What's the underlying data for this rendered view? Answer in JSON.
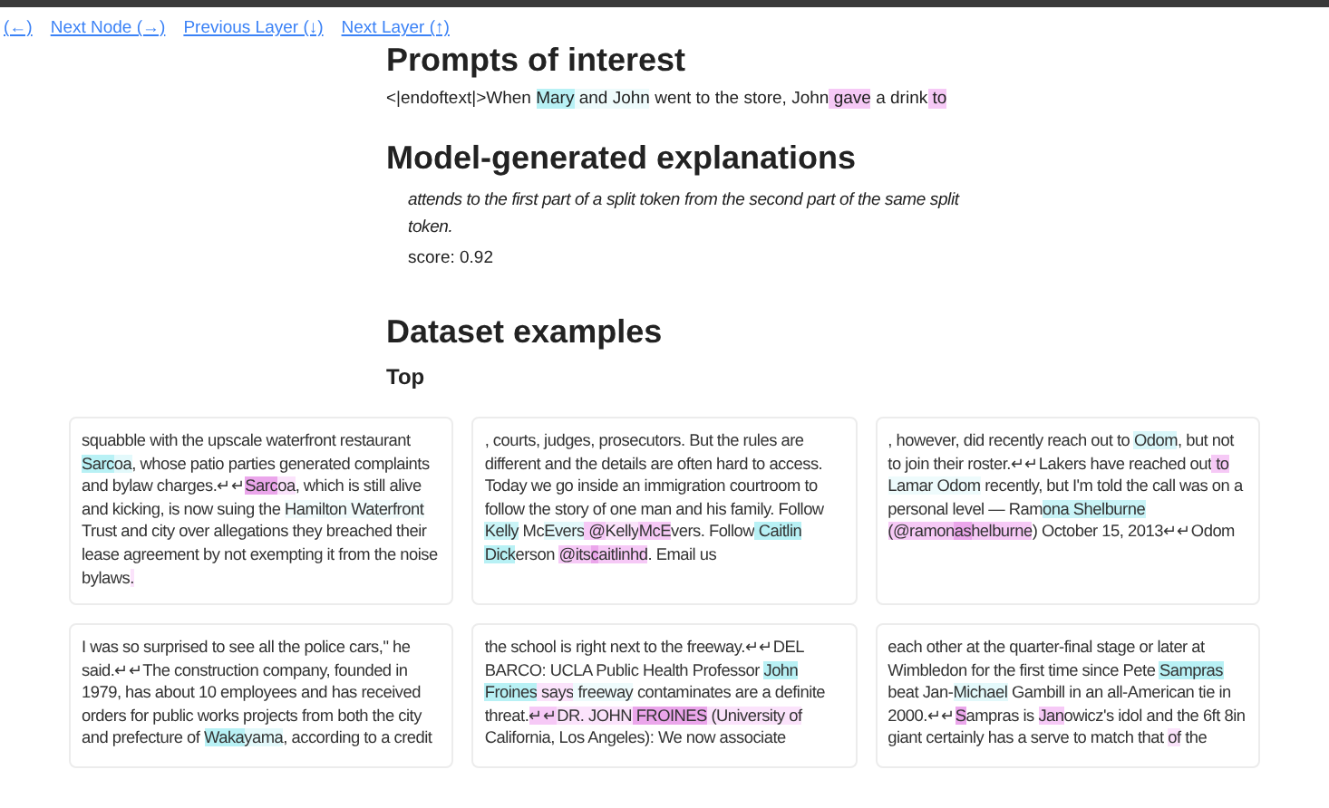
{
  "nav_links": [
    "(←)",
    "Next Node (→)",
    "Previous Layer (↓)",
    "Next Layer (↑)"
  ],
  "prompts": {
    "heading": "Prompts of interest",
    "segments": [
      {
        "text": "<|endoftext|>When "
      },
      {
        "text": "Mary",
        "color": "#b8f1f5"
      },
      {
        "text": " and John",
        "color": "#eefbfc"
      },
      {
        "text": " went to the store, John"
      },
      {
        "text": " gave",
        "color": "#f6c9f6"
      },
      {
        "text": " a drink"
      },
      {
        "text": " to",
        "color": "#f6c9f6"
      }
    ]
  },
  "explanations": {
    "heading": "Model-generated explanations",
    "text": "attends to the first part of a split token from the second part of the same split token.",
    "score": "score: 0.92"
  },
  "dataset": {
    "heading": "Dataset examples",
    "subheading": "Top",
    "examples": [
      [
        {
          "text": " squabble with the upscale waterfront restaurant"
        },
        {
          "text": " Sarc",
          "color": "#b8f1f5"
        },
        {
          "text": "oa",
          "color": "#e3f9fb"
        },
        {
          "text": ", whose patio parties generated complaints and bylaw charges.↵↵"
        },
        {
          "text": "Sarc",
          "color": "#eba6eb"
        },
        {
          "text": "oa",
          "color": "#fbe3fb"
        },
        {
          "text": ", which is still alive and kicking, is now suing the "
        },
        {
          "text": "Hamilton Waterfront",
          "color": "#f1fbfc"
        },
        {
          "text": " Trust and city over allegations they breached their lease agreement by not exempting it from the noise bylaws"
        },
        {
          "text": ".",
          "color": "#fbe3fb"
        }
      ],
      [
        {
          "text": ", courts, judges, prosecutors. But the rules are different and the details are often hard to access. Today we go inside an immigration courtroom to follow the story of one man and his family. Follow"
        },
        {
          "text": " Kelly",
          "color": "#c9f4f7"
        },
        {
          "text": " Mc"
        },
        {
          "text": "Evers",
          "color": "#e3f9fb"
        },
        {
          "text": " @",
          "color": "#f6c9f6"
        },
        {
          "text": "Kelly",
          "color": "#fbe3fb"
        },
        {
          "text": "McE",
          "color": "#f6c9f6"
        },
        {
          "text": "vers. Follow"
        },
        {
          "text": " Caitlin",
          "color": "#b8f1f5"
        },
        {
          "text": " Dick",
          "color": "#b8f1f5"
        },
        {
          "text": "erson "
        },
        {
          "text": "@its",
          "color": "#f6c9f6"
        },
        {
          "text": "c",
          "color": "#eba6eb"
        },
        {
          "text": "aitlinhd",
          "color": "#f6c9f6"
        },
        {
          "text": ". Email us"
        }
      ],
      [
        {
          "text": ", however, did recently reach out to "
        },
        {
          "text": "Odom",
          "color": "#d9f7fa"
        },
        {
          "text": ", but not to join their roster.↵↵Lakers have reached out"
        },
        {
          "text": " to",
          "color": "#f6c9f6"
        },
        {
          "text": " Lamar Odom",
          "color": "#eefbfc"
        },
        {
          "text": " recently, but I'm told the call was on a personal level — Ram"
        },
        {
          "text": "ona Shelburne",
          "color": "#c9f4f7"
        },
        {
          "text": " (@ramon",
          "color": "#f6c9f6"
        },
        {
          "text": "as",
          "color": "#eba6eb"
        },
        {
          "text": "helburne",
          "color": "#f6c9f6"
        },
        {
          "text": ") October 15, 2013↵↵Odom"
        }
      ],
      [
        {
          "text": "I was so surprised to see all the police cars,\" he said.↵↵The construction company, founded in 1979, has about 10 employees and has received orders for public works projects from both the city and prefecture of "
        },
        {
          "text": "Waka",
          "color": "#b8f1f5"
        },
        {
          "text": "yama",
          "color": "#e3f9fb"
        },
        {
          "text": ", according to a credit"
        }
      ],
      [
        {
          "text": " the school is right next to the freeway.↵↵DEL BARCO: UCLA Public Health Professor "
        },
        {
          "text": "John ",
          "color": "#b8f1f5"
        },
        {
          "text": "Froines",
          "color": "#b8f1f5"
        },
        {
          "text": " says",
          "color": "#fbe3fb"
        },
        {
          "text": " freeway",
          "color": "#eefbfc"
        },
        {
          "text": " contaminates are a definite threat."
        },
        {
          "text": "↵↵",
          "color": "#f6c9f6"
        },
        {
          "text": "DR. JOHN",
          "color": "#fbe3fb"
        },
        {
          "text": " FROINES",
          "color": "#eba6eb"
        },
        {
          "text": " (University of",
          "color": "#fbe3fb"
        },
        {
          "text": " California, Los Angeles): We now associate"
        }
      ],
      [
        {
          "text": " each other at the quarter-final stage or later at Wimbledon for the first time since Pete "
        },
        {
          "text": "Sampras",
          "color": "#b8f1f5"
        },
        {
          "text": " beat Jan-"
        },
        {
          "text": "Michael",
          "color": "#e3f9fb"
        },
        {
          "text": " Gambill in an all-American tie in 2000.↵↵"
        },
        {
          "text": "S",
          "color": "#eba6eb"
        },
        {
          "text": "ampras is "
        },
        {
          "text": "Jan",
          "color": "#f6c9f6"
        },
        {
          "text": "owicz's idol and the 6ft 8in giant certainly has a serve to match that "
        },
        {
          "text": "of",
          "color": "#fbe3fb"
        },
        {
          "text": " the"
        }
      ]
    ]
  }
}
